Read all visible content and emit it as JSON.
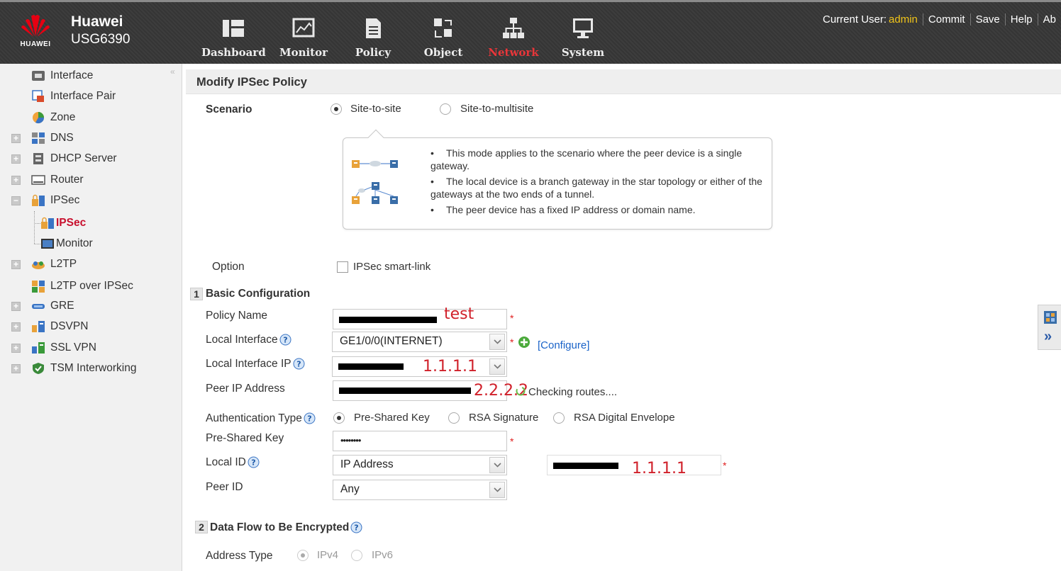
{
  "header": {
    "brand_name": "Huawei",
    "brand_wordmark": "HUAWEI",
    "device_model": "USG6390",
    "nav": [
      {
        "label": "Dashboard",
        "icon": "dashboard-icon"
      },
      {
        "label": "Monitor",
        "icon": "monitor-icon"
      },
      {
        "label": "Policy",
        "icon": "policy-icon"
      },
      {
        "label": "Object",
        "icon": "object-icon"
      },
      {
        "label": "Network",
        "icon": "network-icon",
        "active": true
      },
      {
        "label": "System",
        "icon": "system-icon"
      }
    ],
    "current_user_label": "Current User:",
    "current_user": "admin",
    "links": [
      "Commit",
      "Save",
      "Help",
      "Ab"
    ],
    "colors": {
      "active_nav": "#e8363a",
      "user": "#f0c419"
    }
  },
  "sidebar": {
    "collapse_glyph": "«",
    "items": [
      {
        "label": "Interface",
        "icon": "interface-icon"
      },
      {
        "label": "Interface Pair",
        "icon": "interface-pair-icon"
      },
      {
        "label": "Zone",
        "icon": "zone-icon"
      },
      {
        "label": "DNS",
        "icon": "dns-icon",
        "expander": "+"
      },
      {
        "label": "DHCP Server",
        "icon": "dhcp-server-icon",
        "expander": "+"
      },
      {
        "label": "Router",
        "icon": "router-icon",
        "expander": "+"
      },
      {
        "label": "IPSec",
        "icon": "ipsec-icon",
        "expander": "−"
      },
      {
        "label": "IPSec",
        "icon": "ipsec-icon",
        "active": true
      },
      {
        "label": "Monitor",
        "icon": "monitor-icon"
      },
      {
        "label": "L2TP",
        "icon": "l2tp-icon",
        "expander": "+"
      },
      {
        "label": "L2TP over IPSec",
        "icon": "l2tp-over-ipsec-icon"
      },
      {
        "label": "GRE",
        "icon": "gre-icon",
        "expander": "+"
      },
      {
        "label": "DSVPN",
        "icon": "dsvpn-icon",
        "expander": "+"
      },
      {
        "label": "SSL VPN",
        "icon": "ssl-vpn-icon",
        "expander": "+"
      },
      {
        "label": "TSM Interworking",
        "icon": "tsm-interworking-icon",
        "expander": "+"
      }
    ]
  },
  "page": {
    "title": "Modify IPSec Policy",
    "scenario": {
      "label": "Scenario",
      "options": [
        {
          "label": "Site-to-site",
          "checked": true
        },
        {
          "label": "Site-to-multisite",
          "checked": false
        }
      ],
      "tip": [
        "This mode applies to the scenario where the peer device is a single gateway.",
        "The local device is a branch gateway in the star topology or either of the gateways at the two ends of a tunnel.",
        "The peer device has a fixed IP address or domain name."
      ]
    },
    "option": {
      "label": "Option",
      "checkbox_label": "IPSec smart-link",
      "checked": false
    },
    "basic": {
      "number": "1",
      "title": "Basic Configuration",
      "policy_name": {
        "label": "Policy Name",
        "overlay": "test"
      },
      "local_interface": {
        "label": "Local Interface",
        "value": "GE1/0/0(INTERNET)",
        "configure_link": "[Configure]"
      },
      "local_interface_ip": {
        "label": "Local Interface IP",
        "overlay": "1.1.1.1"
      },
      "peer_ip": {
        "label": "Peer IP Address",
        "overlay": "2.2.2.2",
        "status": "Checking routes...."
      },
      "auth_type": {
        "label": "Authentication Type",
        "options": [
          {
            "label": "Pre-Shared Key",
            "checked": true
          },
          {
            "label": "RSA Signature",
            "checked": false
          },
          {
            "label": "RSA Digital Envelope",
            "checked": false
          }
        ]
      },
      "pre_shared_key": {
        "label": "Pre-Shared Key",
        "value": "••••••••"
      },
      "local_id": {
        "label": "Local ID",
        "value": "IP Address",
        "overlay": "1.1.1.1"
      },
      "peer_id": {
        "label": "Peer ID",
        "value": "Any"
      },
      "required_mark": "*"
    },
    "dataflow": {
      "number": "2",
      "title": "Data Flow to Be Encrypted",
      "address_type": {
        "label": "Address Type",
        "options": [
          {
            "label": "IPv4",
            "checked": true
          },
          {
            "label": "IPv6",
            "checked": false
          }
        ]
      }
    }
  },
  "right_dock": {
    "expand_glyph": "»"
  }
}
